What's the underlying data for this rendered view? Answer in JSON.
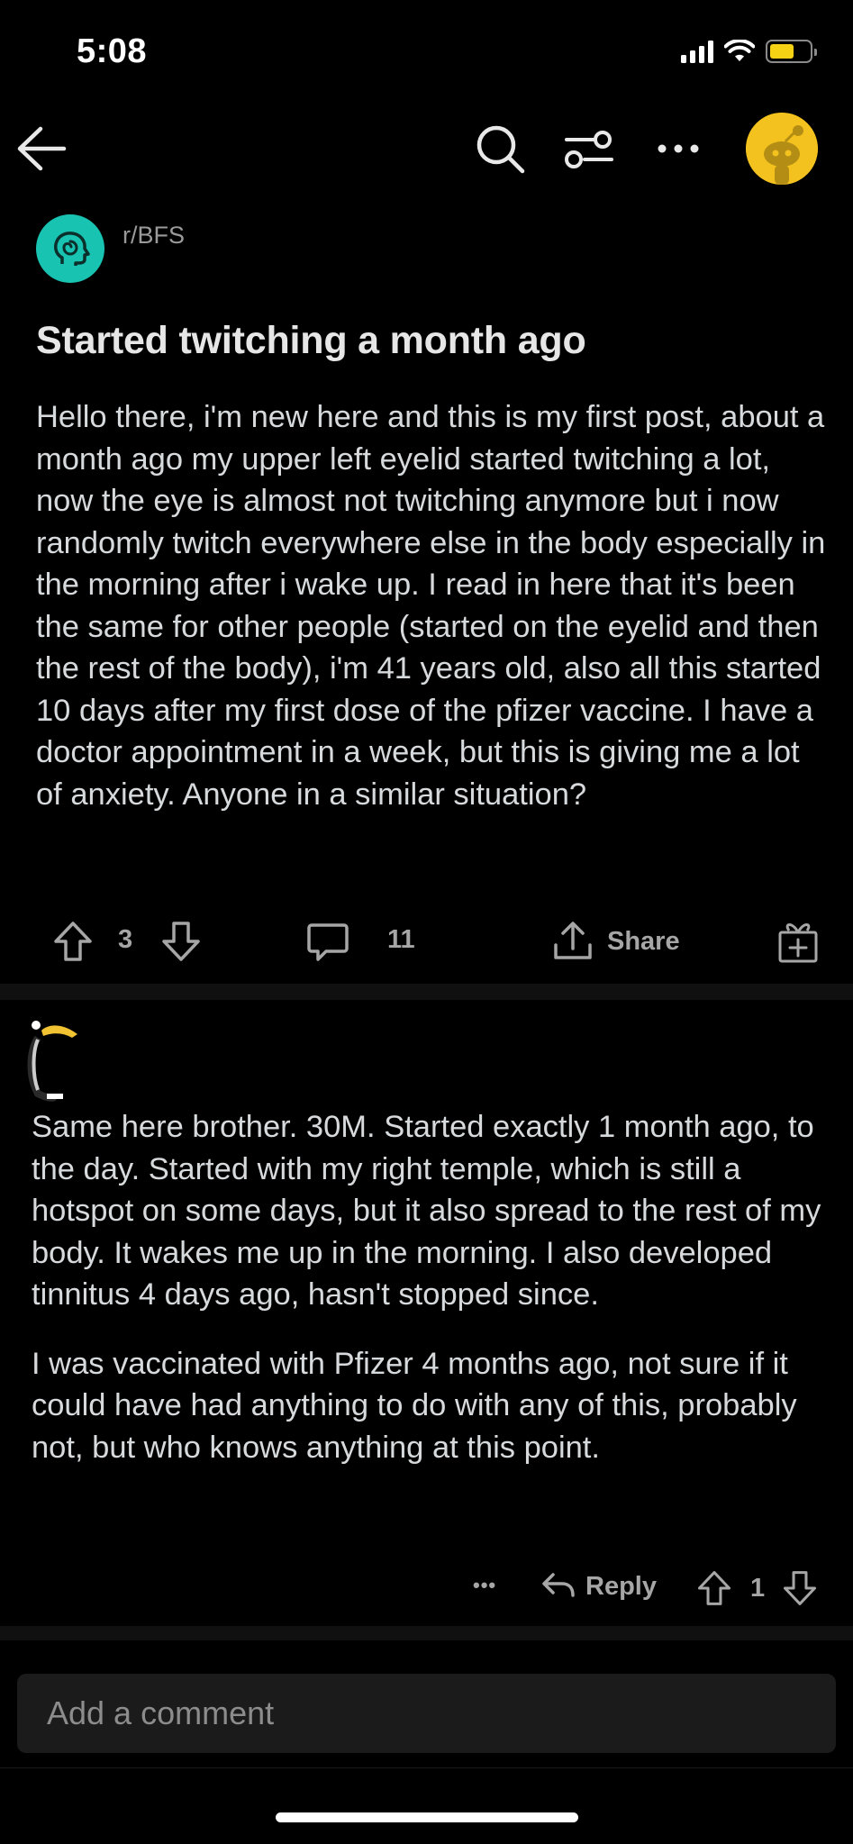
{
  "status_bar": {
    "time": "5:08",
    "battery_color": "#f5d213"
  },
  "nav": {
    "back_icon": "arrow-left-icon",
    "search_icon": "search-icon",
    "filter_icon": "sliders-icon",
    "more_icon": "more-horizontal-icon",
    "avatar_color": "#f4c21e"
  },
  "post": {
    "subreddit": "r/BFS",
    "subreddit_color": "#19c3b1",
    "title": "Started twitching a month ago",
    "body": "Hello there, i'm new here and this is my first post, about a month ago my upper left eyelid started twitching a lot, now the eye is almost not twitching anymore but i now randomly twitch everywhere else in the body especially in the morning after i wake up. I read in here that it's been the same for other people (started on the eyelid and then the rest of the body), i'm 41 years old, also all this started 10 days after my first dose of the pfizer vaccine. I have a doctor appointment in a week, but this is giving me a lot of anxiety. Anyone in a similar situation?",
    "vote_count": "3",
    "comment_count": "11",
    "share_label": "Share"
  },
  "comment": {
    "paragraphs": [
      "Same here brother. 30M. Started exactly 1 month ago, to the day. Started with my right temple, which is still a hotspot on some days, but it also spread to the rest of my body. It wakes me up in the morning. I also developed tinnitus 4 days ago, hasn't stopped since.",
      "I was vaccinated with Pfizer 4 months ago, not sure if it could have had anything to do with any of this, probably not, but who knows anything at this point."
    ],
    "more_label": "•••",
    "reply_label": "Reply",
    "vote_count": "1"
  },
  "comment_box": {
    "placeholder": "Add a comment"
  }
}
